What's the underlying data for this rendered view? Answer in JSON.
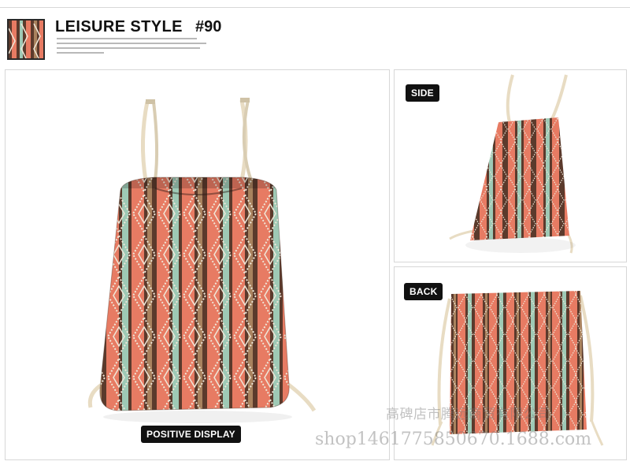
{
  "header": {
    "title": "LEISURE STYLE",
    "code": "#90"
  },
  "labels": {
    "front": "POSITIVE DISPLAY",
    "side": "SIDE",
    "back": "BACK"
  },
  "watermark": {
    "company": "高碑店市腾远商贸有限公司",
    "url": "shop1461775850670.1688.com"
  },
  "colors": {
    "coral": "#e77b63",
    "brown": "#5b3a2c",
    "mint": "#9ec9b5",
    "cream": "#efe7d8",
    "tan": "#a9825e",
    "rope": "#e8dcc3"
  }
}
